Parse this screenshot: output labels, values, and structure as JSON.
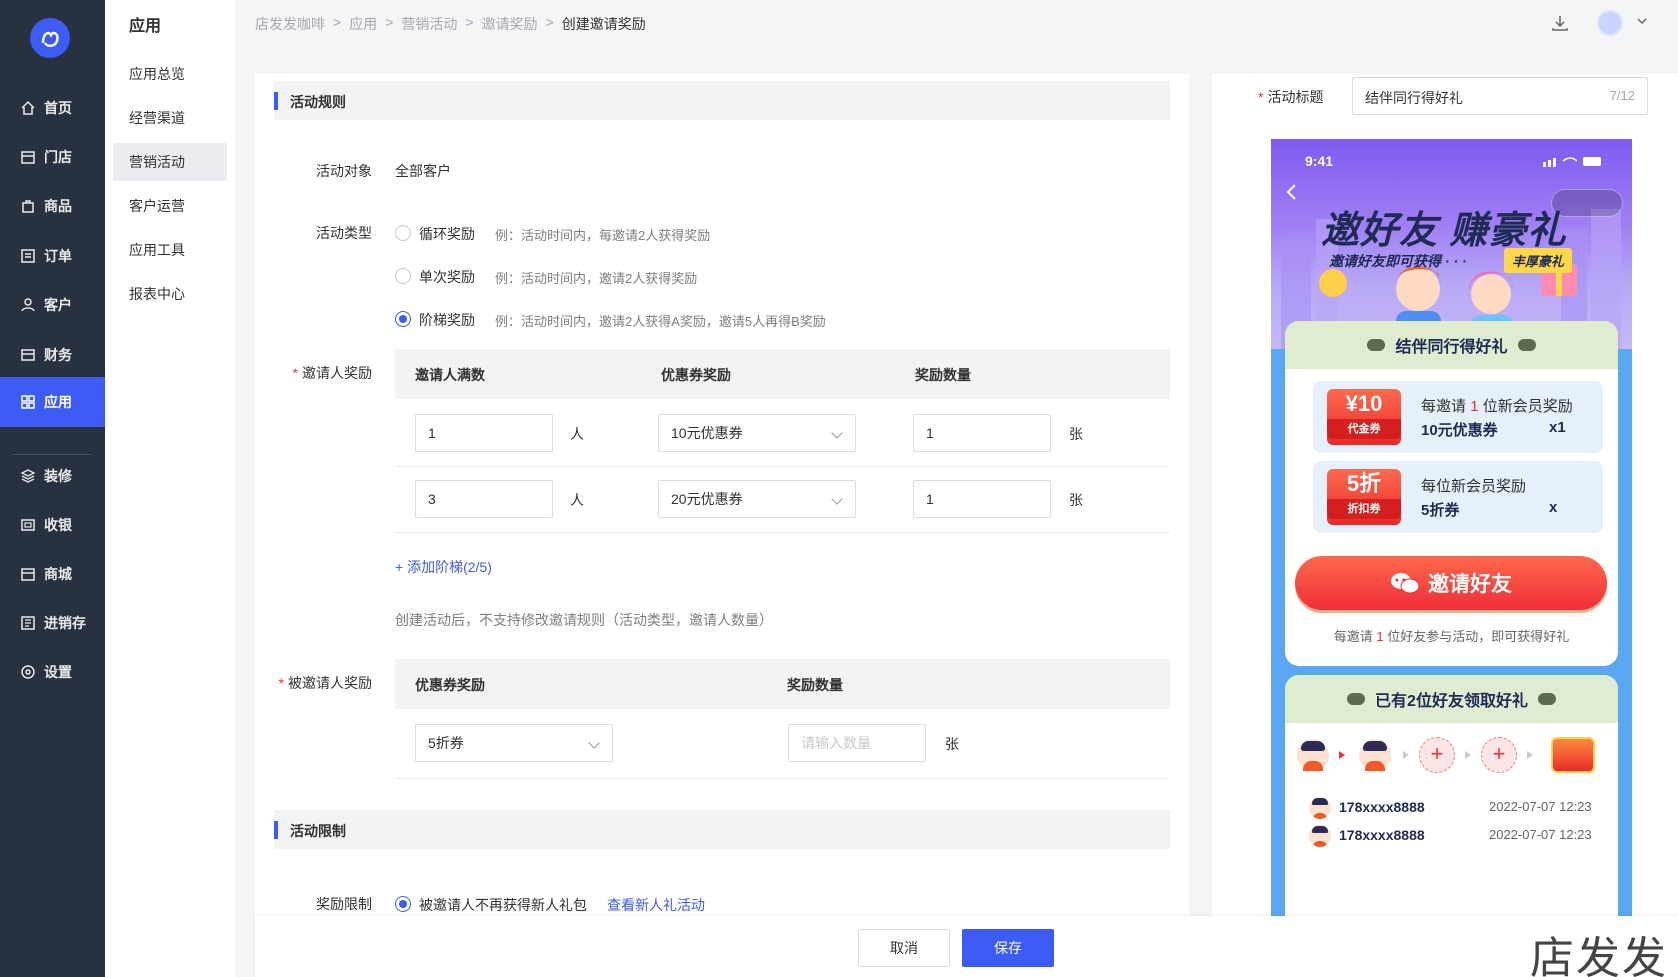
{
  "nav": {
    "items": [
      {
        "label": "首页",
        "icon": "home-icon"
      },
      {
        "label": "门店",
        "icon": "store-icon"
      },
      {
        "label": "商品",
        "icon": "bag-icon"
      },
      {
        "label": "订单",
        "icon": "order-icon"
      },
      {
        "label": "客户",
        "icon": "user-icon"
      },
      {
        "label": "财务",
        "icon": "card-icon"
      },
      {
        "label": "应用",
        "icon": "apps-icon"
      },
      {
        "label": "装修",
        "icon": "layers-icon"
      },
      {
        "label": "收银",
        "icon": "cashier-icon"
      },
      {
        "label": "商城",
        "icon": "shop-icon"
      },
      {
        "label": "进销存",
        "icon": "inventory-icon"
      },
      {
        "label": "设置",
        "icon": "settings-icon"
      }
    ],
    "active": "应用"
  },
  "subnav": {
    "title": "应用",
    "items": [
      "应用总览",
      "经营渠道",
      "营销活动",
      "客户运营",
      "应用工具",
      "报表中心"
    ],
    "active": "营销活动"
  },
  "breadcrumb": [
    "店发发咖啡",
    "应用",
    "营销活动",
    "邀请奖励",
    "创建邀请奖励"
  ],
  "breadcrumb_sep": ">",
  "form": {
    "section_rules": "活动规则",
    "target_label": "活动对象",
    "target_value": "全部客户",
    "type_label": "活动类型",
    "types": [
      {
        "label": "循环奖励",
        "hint": "例：活动时间内，每邀请2人获得奖励",
        "checked": false
      },
      {
        "label": "单次奖励",
        "hint": "例：活动时间内，邀请2人获得奖励",
        "checked": false
      },
      {
        "label": "阶梯奖励",
        "hint": "例：活动时间内，邀请2人获得A奖励，邀请5人再得B奖励",
        "checked": true
      }
    ],
    "inviter_label": "邀请人奖励",
    "inviter_cols": [
      "邀请人满数",
      "优惠券奖励",
      "奖励数量"
    ],
    "inviter_rows": [
      {
        "count": "1",
        "count_unit": "人",
        "coupon": "10元优惠券",
        "qty": "1",
        "qty_unit": "张"
      },
      {
        "count": "3",
        "count_unit": "人",
        "coupon": "20元优惠券",
        "qty": "1",
        "qty_unit": "张"
      }
    ],
    "add_tier": "+ 添加阶梯(2/5)",
    "note": "创建活动后，不支持修改邀请规则（活动类型，邀请人数量）",
    "invitee_label": "被邀请人奖励",
    "invitee_cols": [
      "优惠券奖励",
      "奖励数量"
    ],
    "invitee_coupon": "5折券",
    "invitee_qty_placeholder": "请输入数量",
    "invitee_qty_unit": "张",
    "section_limit": "活动限制",
    "limit_label": "奖励限制",
    "limit_option": "被邀请人不再获得新人礼包",
    "limit_link": "查看新人礼活动"
  },
  "footer": {
    "cancel": "取消",
    "save": "保存"
  },
  "watermark": "店发发",
  "preview": {
    "title_label": "活动标题",
    "title_value": "结伴同行得好礼",
    "title_count": "7/12",
    "status_time": "9:41",
    "hero_title": "邀好友 赚豪礼",
    "hero_sub": "邀请好友即可获得 · · ·",
    "hero_tag": "丰厚豪礼",
    "card_title": "结伴同行得好礼",
    "coupon1": {
      "big": "¥10",
      "small": "代金券",
      "line1_pre": "每邀请",
      "line1_num": "1",
      "line1_post": "位新会员奖励",
      "name": "10元优惠券",
      "mult": "x1"
    },
    "coupon2": {
      "big": "5折",
      "small": "折扣券",
      "line1": "每位新会员奖励",
      "name": "5折券",
      "mult": "x"
    },
    "invite_btn": "邀请好友",
    "invite_hint_pre": "每邀请",
    "invite_hint_num": "1",
    "invite_hint_post": "位好友参与活动，即可获得好礼",
    "friends_title": "已有2位好友领取好礼",
    "records": [
      {
        "phone": "178xxxx8888",
        "time": "2022-07-07 12:23"
      },
      {
        "phone": "178xxxx8888",
        "time": "2022-07-07 12:23"
      }
    ]
  },
  "colors": {
    "primary": "#3d5bf5",
    "nav_bg": "#28313f",
    "danger": "#e33",
    "hero": "#7d5bf0",
    "phone_bg": "#5aa7f2"
  }
}
